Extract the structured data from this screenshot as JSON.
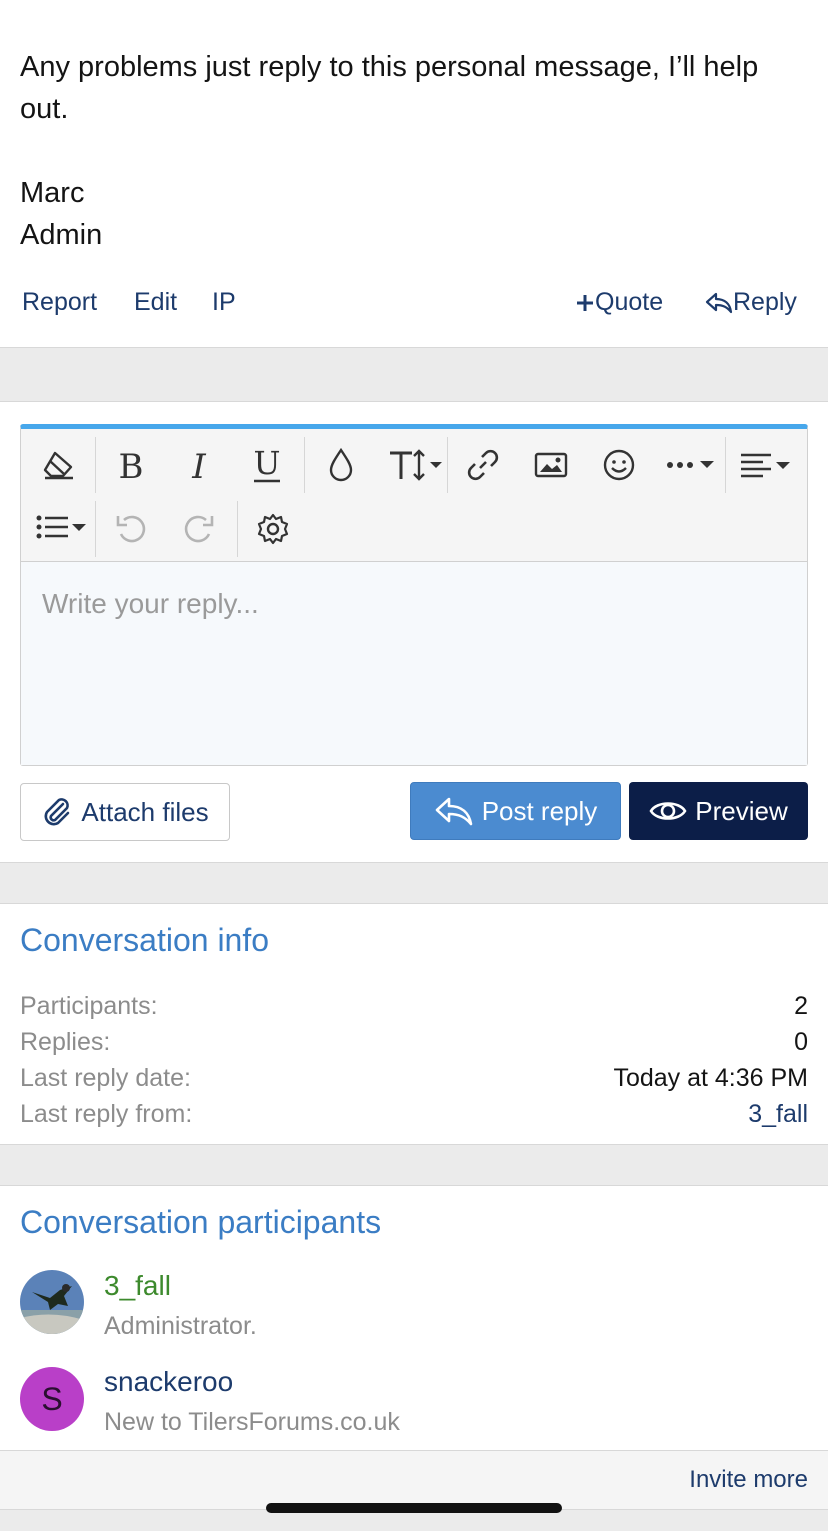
{
  "message": {
    "line1": "Any problems just reply to this personal message, I’ll help",
    "line2": "out.",
    "signature_name": "Marc",
    "signature_role": "Admin"
  },
  "post_actions": {
    "report": "Report",
    "edit": "Edit",
    "ip": "IP",
    "quote": "Quote",
    "reply": "Reply"
  },
  "editor": {
    "toolbar_icons": [
      "eraser-icon",
      "bold-icon",
      "italic-icon",
      "underline-icon",
      "color-icon",
      "text-size-icon",
      "link-icon",
      "image-icon",
      "smiley-icon",
      "more-icon",
      "align-icon",
      "list-icon",
      "undo-icon",
      "redo-icon",
      "settings-icon"
    ],
    "placeholder": "Write your reply..."
  },
  "buttons": {
    "attach": "Attach files",
    "post_reply": "Post reply",
    "preview": "Preview"
  },
  "conversation_info": {
    "title": "Conversation info",
    "rows": [
      {
        "label": "Participants:",
        "value": "2"
      },
      {
        "label": "Replies:",
        "value": "0"
      },
      {
        "label": "Last reply date:",
        "value": "Today at 4:36 PM"
      },
      {
        "label": "Last reply from:",
        "value": "3_fall"
      }
    ]
  },
  "participants": {
    "title": "Conversation participants",
    "list": [
      {
        "name": "3_fall",
        "role": "Administrator.",
        "name_color": "#3d8a2d"
      },
      {
        "name": "snackeroo",
        "role": "New to TilersForums.co.uk",
        "avatar_letter": "S",
        "avatar_color": "#b93fc8"
      }
    ],
    "invite": "Invite more"
  },
  "colors": {
    "accent": "#47a7eb",
    "link": "#1d3b6c",
    "title": "#3b7dc4",
    "post_button": "#4b8bd0",
    "preview_button": "#0c1e48"
  }
}
